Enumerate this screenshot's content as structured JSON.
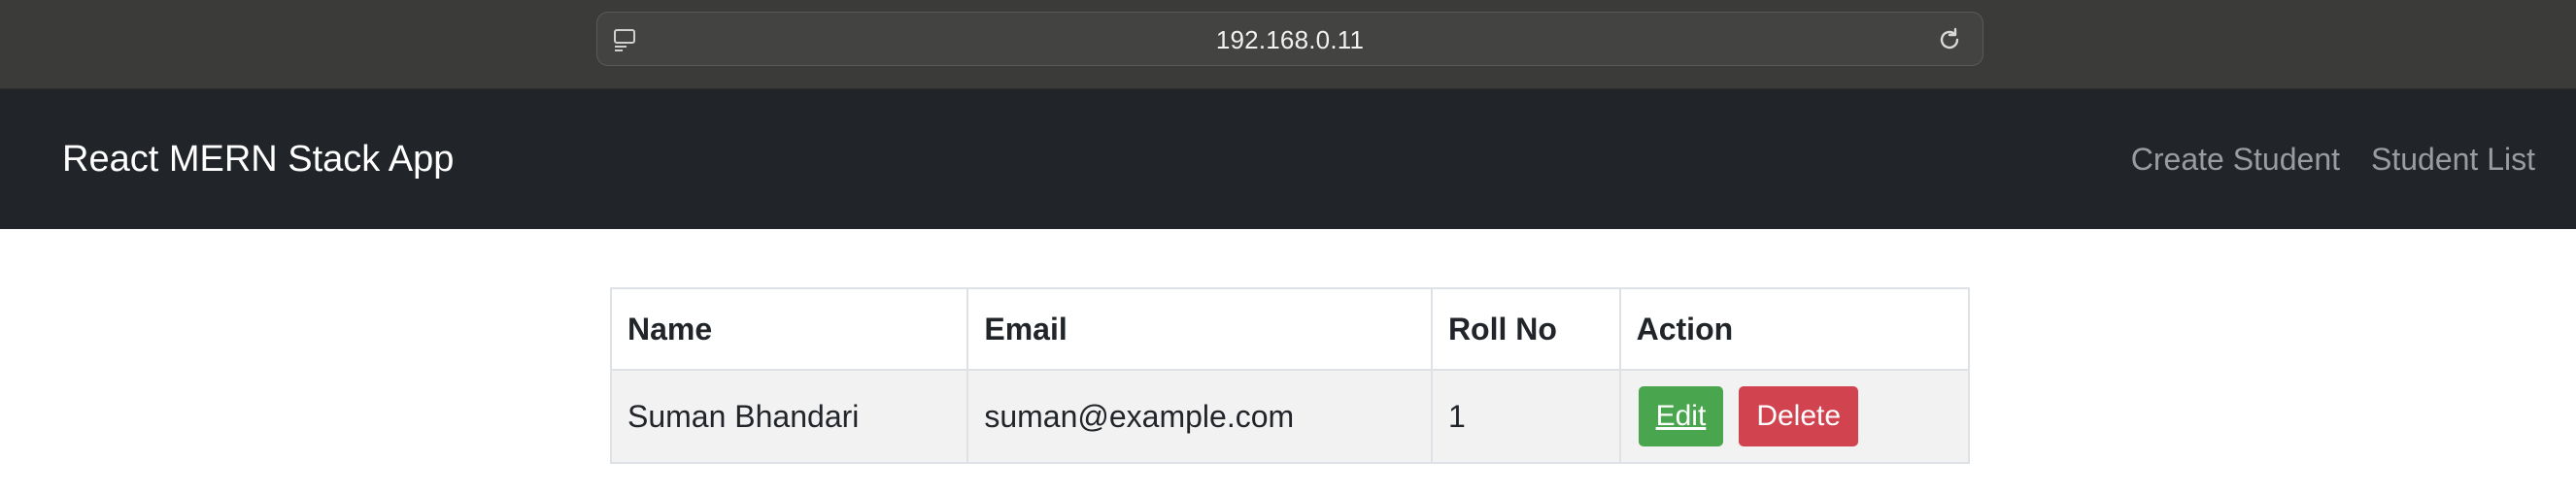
{
  "browser": {
    "url": "192.168.0.11",
    "left_icon": "page-info-icon",
    "right_icon": "reload-icon"
  },
  "navbar": {
    "brand": "React MERN Stack App",
    "links": [
      {
        "label": "Create Student"
      },
      {
        "label": "Student List"
      }
    ],
    "background": "#212529"
  },
  "table": {
    "headers": [
      "Name",
      "Email",
      "Roll No",
      "Action"
    ],
    "rows": [
      {
        "name": "Suman Bhandari",
        "email": "suman@example.com",
        "roll_no": "1",
        "edit_label": "Edit",
        "delete_label": "Delete"
      }
    ]
  },
  "colors": {
    "edit_button": "#4aa64e",
    "delete_button": "#d0434f"
  }
}
